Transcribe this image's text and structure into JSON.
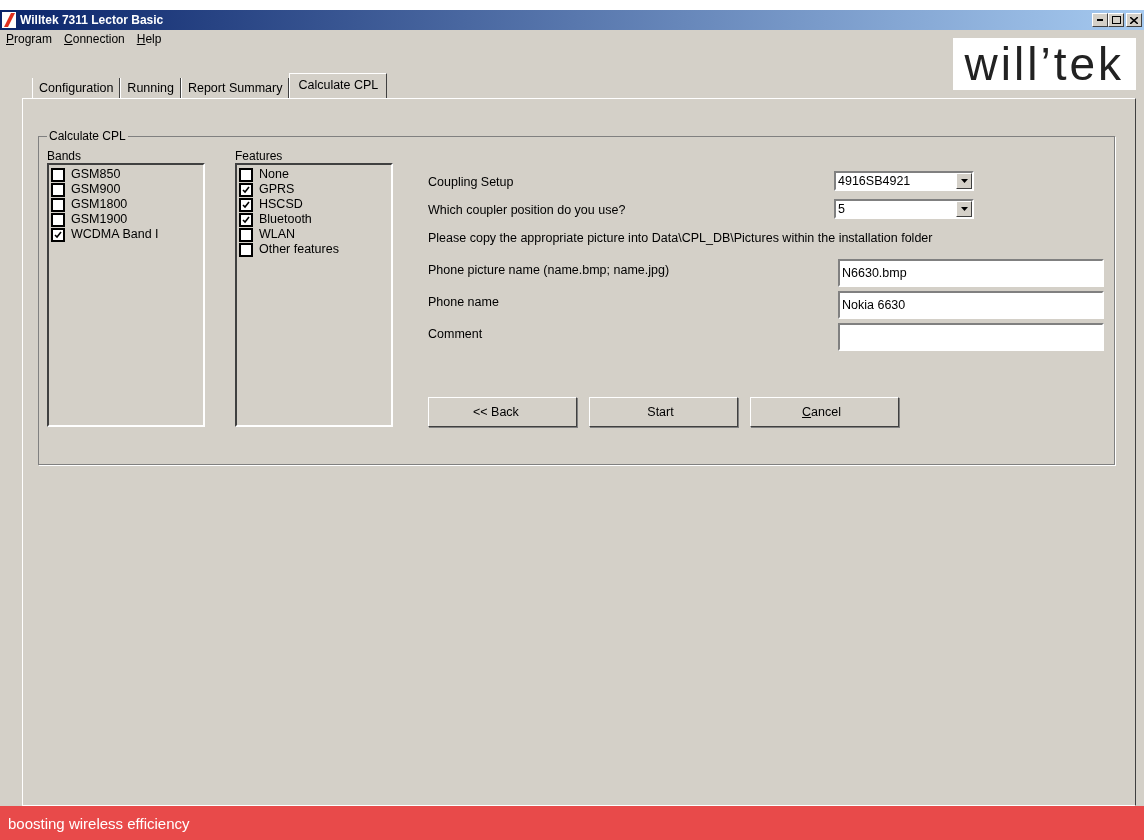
{
  "window": {
    "title": "Willtek 7311 Lector Basic"
  },
  "menu": [
    {
      "label": "Program"
    },
    {
      "label": "Connection"
    },
    {
      "label": "Help"
    }
  ],
  "logo": "will’tek",
  "tabs": [
    {
      "label": "Configuration",
      "selected": false
    },
    {
      "label": "Running",
      "selected": false
    },
    {
      "label": "Report Summary",
      "selected": false
    },
    {
      "label": "Calculate CPL",
      "selected": true
    }
  ],
  "group": {
    "title": "Calculate CPL",
    "bands": {
      "title": "Bands",
      "items": [
        {
          "label": "GSM850",
          "checked": false
        },
        {
          "label": "GSM900",
          "checked": false
        },
        {
          "label": "GSM1800",
          "checked": false
        },
        {
          "label": "GSM1900",
          "checked": false
        },
        {
          "label": "WCDMA Band I",
          "checked": true
        }
      ]
    },
    "features": {
      "title": "Features",
      "items": [
        {
          "label": "None",
          "checked": false
        },
        {
          "label": "GPRS",
          "checked": true
        },
        {
          "label": "HSCSD",
          "checked": true
        },
        {
          "label": "Bluetooth",
          "checked": true
        },
        {
          "label": "WLAN",
          "checked": false
        },
        {
          "label": "Other features",
          "checked": false
        }
      ]
    },
    "fields": [
      {
        "kind": "select",
        "label": "Coupling Setup",
        "value": "4916SB4921"
      },
      {
        "kind": "select",
        "label": "Which coupler position do you use?",
        "value": "5"
      },
      {
        "kind": "note",
        "label": "Please copy the appropriate picture into Data\\CPL_DB\\Pictures within the installation folder"
      },
      {
        "kind": "text",
        "label": "Phone picture name (name.bmp; name.jpg)",
        "value": "N6630.bmp"
      },
      {
        "kind": "text",
        "label": "Phone name",
        "value": "Nokia 6630"
      },
      {
        "kind": "text",
        "label": "Comment"
      }
    ],
    "buttons": [
      "<<  Back",
      "Start",
      "Cancel"
    ]
  },
  "footer": "boosting wireless efficiency"
}
